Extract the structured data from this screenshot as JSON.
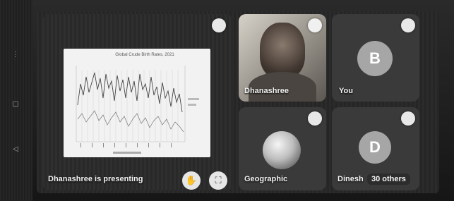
{
  "presenting": {
    "label": "Dhanashree is presenting",
    "slide_title": "Global Crude Birth Rates, 2021"
  },
  "participants": [
    {
      "name": "Dhanashree",
      "kind": "video"
    },
    {
      "name": "You",
      "initial": "B"
    },
    {
      "name": "Geographic",
      "kind": "photo"
    },
    {
      "name": "Dinesh",
      "initial": "D"
    }
  ],
  "others": {
    "label": "30 others"
  },
  "icons": {
    "pin": "pin-icon",
    "audio": "audio-wave-icon",
    "mic_off": "hand-raise-icon",
    "fullscreen": "fullscreen-icon"
  },
  "colors": {
    "background": "#1c1c1c",
    "tile": "#3a3a3a",
    "avatar": "#a6a6a6"
  }
}
